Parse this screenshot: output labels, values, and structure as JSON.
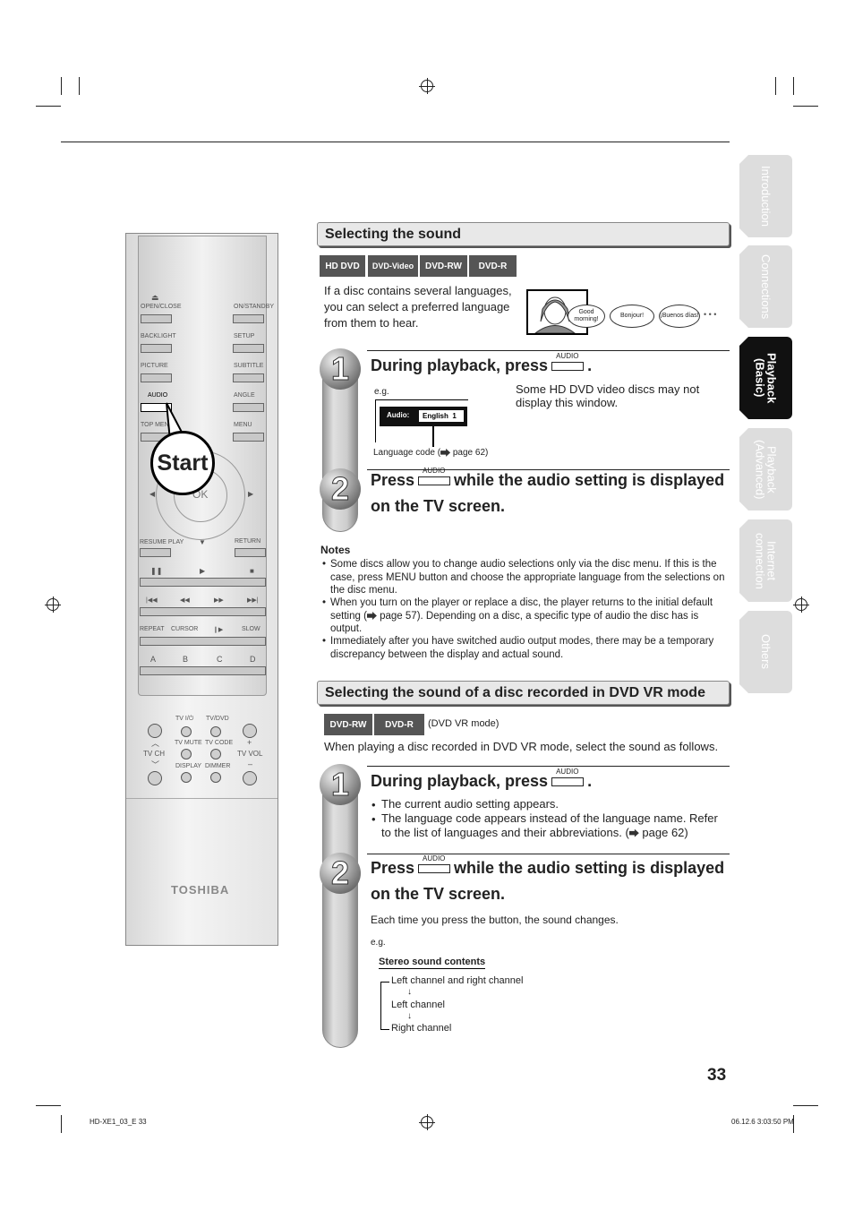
{
  "remote": {
    "labels": {
      "open_close": "OPEN/CLOSE",
      "on_standby": "ON/STANDBY",
      "backlight": "BACKLIGHT",
      "setup": "SETUP",
      "picture": "PICTURE",
      "subtitle": "SUBTITLE",
      "audio": "AUDIO",
      "angle": "ANGLE",
      "top_menu": "TOP MENU",
      "menu": "MENU",
      "ok": "OK",
      "resume_play": "RESUME PLAY",
      "return": "RETURN",
      "repeat": "REPEAT",
      "cursor": "CURSOR",
      "slow": "SLOW",
      "a": "A",
      "b": "B",
      "c": "C",
      "d": "D",
      "tv_power": "TV I/⏻",
      "tv_dvd": "TV/DVD",
      "tv_mute": "TV MUTE",
      "tv_code": "TV CODE",
      "tv_ch": "TV CH",
      "tv_vol": "TV VOL",
      "display": "DISPLAY",
      "dimmer": "DIMMER",
      "plus": "+",
      "minus": "–"
    },
    "start_callout": "Start",
    "brand": "TOSHIBA"
  },
  "section1": {
    "title": "Selecting the sound",
    "badges": [
      "HD DVD",
      "DVD-Video",
      "DVD-RW",
      "DVD-R"
    ],
    "intro": "If a disc contains several languages, you can select a preferred language from them to hear.",
    "bubbles": [
      "Good morning!",
      "Bonjour!",
      "¡Buenos días!"
    ],
    "ellipsis": "• • •",
    "step1": {
      "number": "1",
      "heading_pre": "During playback, press",
      "key": "AUDIO",
      "heading_post": ".",
      "eg": "e.g.",
      "osd_label": "Audio:",
      "osd_value": "English  1",
      "language_code_pre": "Language code (",
      "language_code_post": "page 62)",
      "note": "Some HD DVD video discs may not display this window."
    },
    "step2": {
      "number": "2",
      "heading_pre": "Press",
      "key": "AUDIO",
      "heading_post": "while the audio setting is displayed",
      "heading_line2": "on the TV screen."
    },
    "notes_title": "Notes",
    "notes": [
      "Some discs allow you to change audio selections only via the disc menu. If this is the case, press MENU button and choose the appropriate language from the selections on the disc menu.",
      "When you turn on the player or replace a disc, the player returns to the initial default setting (",
      "page 57). Depending on a disc, a specific type of audio the disc has is output.",
      "Immediately after you have switched audio output modes, there may be a temporary discrepancy between the display and actual sound."
    ]
  },
  "section2": {
    "title": "Selecting the sound of a disc recorded in DVD VR mode",
    "badges": [
      "DVD-RW",
      "DVD-R"
    ],
    "mode_note": "(DVD VR mode)",
    "intro": "When playing a disc recorded in DVD VR mode, select the sound as follows.",
    "step1": {
      "number": "1",
      "heading_pre": "During playback, press",
      "key": "AUDIO",
      "heading_post": ".",
      "bullets": [
        "The current audio setting appears.",
        "The language code appears instead of the language name. Refer to the list of languages and their abbreviations. (",
        "page 62)"
      ]
    },
    "step2": {
      "number": "2",
      "heading_pre": "Press",
      "key": "AUDIO",
      "heading_post": "while the audio setting is displayed",
      "heading_line2": "on the TV screen.",
      "body": "Each time you press the button, the sound changes.",
      "eg": "e.g.",
      "stereo_title": "Stereo sound contents",
      "stereo": [
        "Left channel and right channel",
        "Left channel",
        "Right channel"
      ]
    }
  },
  "tabs": [
    {
      "label": "Introduction",
      "active": false
    },
    {
      "label": "Connections",
      "active": false
    },
    {
      "label": "Playback (Basic)",
      "active": true
    },
    {
      "label": "Playback (Advanced)",
      "active": false
    },
    {
      "label": "Internet connection",
      "active": false
    },
    {
      "label": "Others",
      "active": false
    }
  ],
  "page_number": "33",
  "footer": {
    "left": "HD-XE1_03_E  33",
    "right": "06.12.6  3:03:50 PM"
  }
}
